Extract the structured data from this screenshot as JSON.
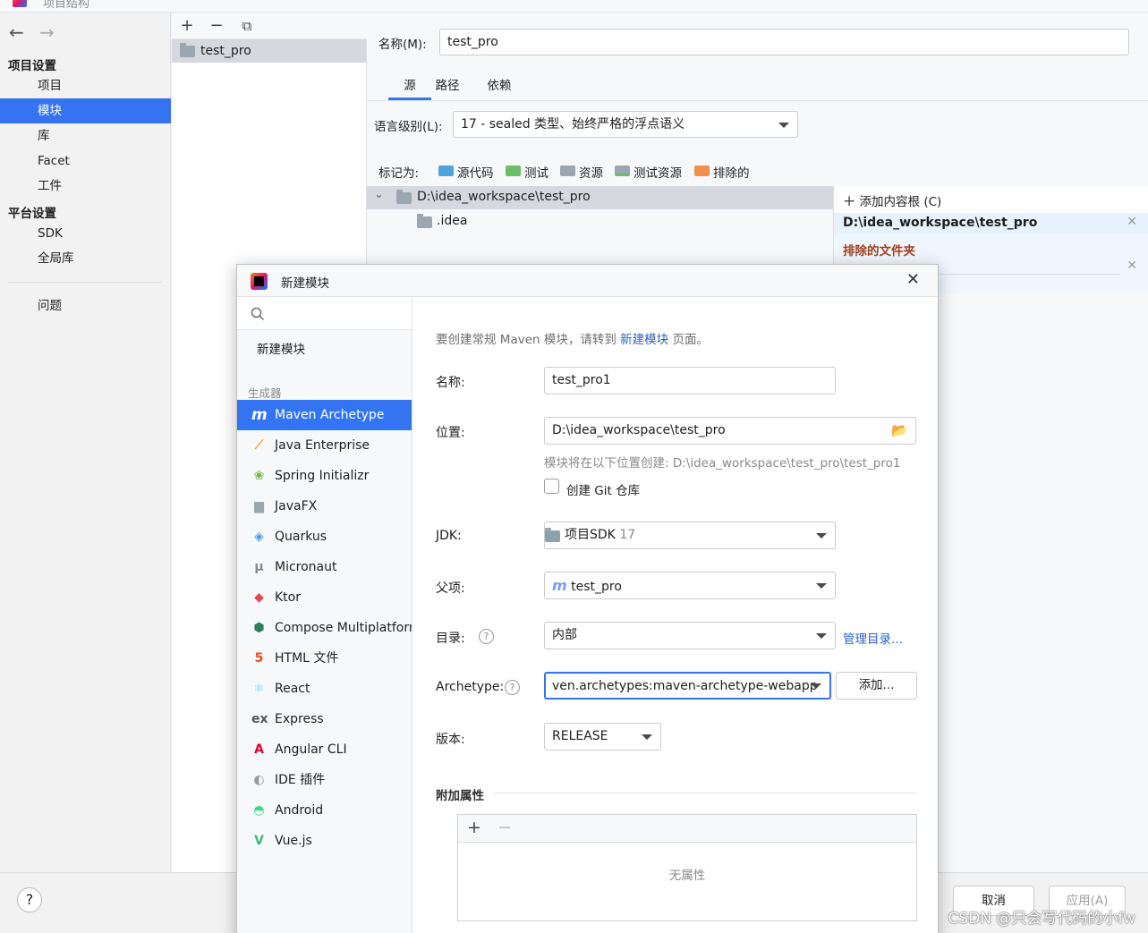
{
  "window": {
    "title": "项目结构"
  },
  "sidebar": {
    "project_settings_title": "项目设置",
    "project_items": [
      "项目",
      "模块",
      "库",
      "Facet",
      "工件"
    ],
    "platform_settings_title": "平台设置",
    "platform_items": [
      "SDK",
      "全局库"
    ],
    "problems": "问题",
    "selected": "模块"
  },
  "modules": {
    "items": [
      "test_pro"
    ]
  },
  "module_editor": {
    "name_label": "名称(M):",
    "name_value": "test_pro",
    "tabs": [
      "源",
      "路径",
      "依赖"
    ],
    "active_tab": "源",
    "language_level_label": "语言级别(L):",
    "language_level_value": "17 - sealed 类型、始终严格的浮点语义",
    "mark_as_label": "标记为:",
    "mark_as": [
      {
        "label": "源代码",
        "color": "#4ea3e0"
      },
      {
        "label": "测试",
        "color": "#6abf69"
      },
      {
        "label": "资源",
        "color": "#9aa7b0"
      },
      {
        "label": "测试资源",
        "color": "#9aa7b0"
      },
      {
        "label": "排除的",
        "color": "#f0904a"
      }
    ],
    "tree_root": "D:\\idea_workspace\\test_pro",
    "tree_child": ".idea",
    "add_content_root": "添加内容根 (C)",
    "content_root_path": "D:\\idea_workspace\\test_pro",
    "excluded_folders": "排除的文件夹"
  },
  "bottom": {
    "help": "?",
    "cancel": "取消",
    "apply": "应用(A)"
  },
  "dialog": {
    "title": "新建模块",
    "search_placeholder": "",
    "new_module": "新建模块",
    "generators_title": "生成器",
    "generators": [
      {
        "label": "Maven Archetype",
        "icon": "maven-icon",
        "glyph": "m",
        "color": "#7b9fee"
      },
      {
        "label": "Java Enterprise",
        "icon": "java-enterprise-icon",
        "glyph": "⟋",
        "color": "#f5a623"
      },
      {
        "label": "Spring Initializr",
        "icon": "spring-icon",
        "glyph": "❀",
        "color": "#6db33f"
      },
      {
        "label": "JavaFX",
        "icon": "javafx-icon",
        "glyph": "▆",
        "color": "#9aa7b0"
      },
      {
        "label": "Quarkus",
        "icon": "quarkus-icon",
        "glyph": "◈",
        "color": "#4695eb"
      },
      {
        "label": "Micronaut",
        "icon": "micronaut-icon",
        "glyph": "μ",
        "color": "#8a8a8a"
      },
      {
        "label": "Ktor",
        "icon": "ktor-icon",
        "glyph": "◆",
        "color": "#e44857"
      },
      {
        "label": "Compose Multiplatform",
        "icon": "compose-icon",
        "glyph": "⬢",
        "color": "#2e7d5b"
      },
      {
        "label": "HTML 文件",
        "icon": "html-icon",
        "glyph": "5",
        "color": "#e44d26"
      },
      {
        "label": "React",
        "icon": "react-icon",
        "glyph": "⚛",
        "color": "#61dafb"
      },
      {
        "label": "Express",
        "icon": "express-icon",
        "glyph": "ex",
        "color": "#555555"
      },
      {
        "label": "Angular CLI",
        "icon": "angular-icon",
        "glyph": "A",
        "color": "#dd0031"
      },
      {
        "label": "IDE 插件",
        "icon": "plugin-icon",
        "glyph": "◐",
        "color": "#9a9a9a"
      },
      {
        "label": "Android",
        "icon": "android-icon",
        "glyph": "◓",
        "color": "#3ddc84"
      },
      {
        "label": "Vue.js",
        "icon": "vue-icon",
        "glyph": "V",
        "color": "#41b883"
      }
    ],
    "selected_generator": "Maven Archetype",
    "form": {
      "hint_prefix": "要创建常规 Maven 模块，请转到",
      "hint_link": "新建模块",
      "hint_suffix": "页面。",
      "name_label": "名称:",
      "name_value": "test_pro1",
      "location_label": "位置:",
      "location_value": "D:\\idea_workspace\\test_pro",
      "location_hint": "模块将在以下位置创建: D:\\idea_workspace\\test_pro\\test_pro1",
      "git_label": "创建 Git 仓库",
      "git_checked": false,
      "jdk_label": "JDK:",
      "jdk_value": "项目SDK",
      "jdk_version": "17",
      "parent_label": "父项:",
      "parent_value": "test_pro",
      "catalog_label": "目录:",
      "catalog_value": "内部",
      "catalog_manage": "管理目录...",
      "archetype_label": "Archetype:",
      "archetype_value": "ven.archetypes:maven-archetype-webapp",
      "archetype_add": "添加...",
      "version_label": "版本:",
      "version_value": "RELEASE",
      "extra_props_title": "附加属性",
      "no_props": "无属性"
    }
  },
  "watermark": "CSDN @只会写代码的小fw"
}
